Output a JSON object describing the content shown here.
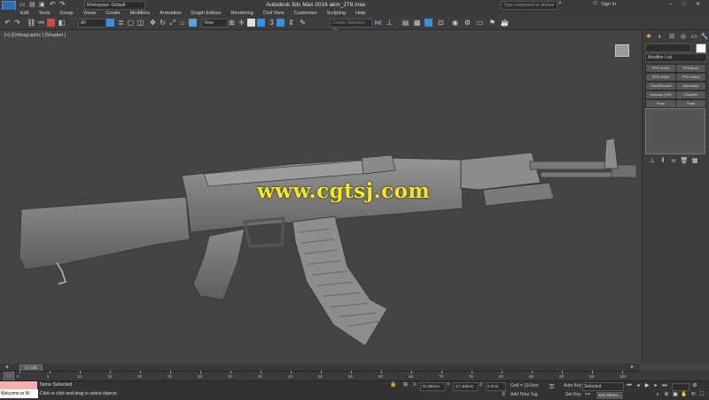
{
  "window": {
    "title": "Autodesk 3ds Max 2016     akm_278.max",
    "workspace": "Workspace: Default",
    "search_placeholder": "Type a keyword or phrase",
    "sign_in": "Sign In",
    "minimize": "–",
    "maximize": "□",
    "close": "✕"
  },
  "menu": [
    "Edit",
    "Tools",
    "Group",
    "Views",
    "Create",
    "Modifiers",
    "Animation",
    "Graph Editors",
    "Rendering",
    "Civil View",
    "Customize",
    "Scripting",
    "Help"
  ],
  "toolbar": {
    "filter_value": "All",
    "refcoord_value": "View",
    "named_selection_placeholder": "Create Selection Se"
  },
  "viewport": {
    "label": "[+] [Orthographic ] [Shaded ]",
    "watermark": "www.cgtsj.com"
  },
  "command_panel": {
    "modifier_list": "Modifier List",
    "object_color": "#ffffff",
    "modifier_buttons": [
      "FFD 2x2x2",
      "FFD(box)",
      "FFD 3x3x3",
      "FFD 4x4x4",
      "TurboSmooth",
      "Symmetry",
      "Unwrap UVW",
      "Chamfer",
      "Push",
      "Shell"
    ]
  },
  "timeline": {
    "slider_label": "0 / 100",
    "ticks": [
      "0",
      "5",
      "10",
      "15",
      "20",
      "25",
      "30",
      "35",
      "40",
      "45",
      "50",
      "55",
      "60",
      "65",
      "70",
      "75",
      "80",
      "85",
      "90",
      "95",
      "100"
    ]
  },
  "status": {
    "listener_text": "Welcome to M",
    "selection": "None Selected",
    "hint": "Click or click-and-drag to select objects",
    "x_label": "X:",
    "x_value": "75.365cm",
    "y_label": "Y:",
    "y_value": "-17.469cm",
    "z_label": "Z:",
    "z_value": "0.0cm",
    "grid": "Grid = 10.0cm",
    "add_time_tag": "Add Time Tag",
    "auto_key": "Auto Key",
    "set_key": "Set Key",
    "selected_dropdown": "Selected",
    "key_filters": "Key Filters..."
  },
  "colors": {
    "viewport_bg": "#444444",
    "watermark": "#f6e81a",
    "maxscript_listener": "#f2b0b0"
  }
}
